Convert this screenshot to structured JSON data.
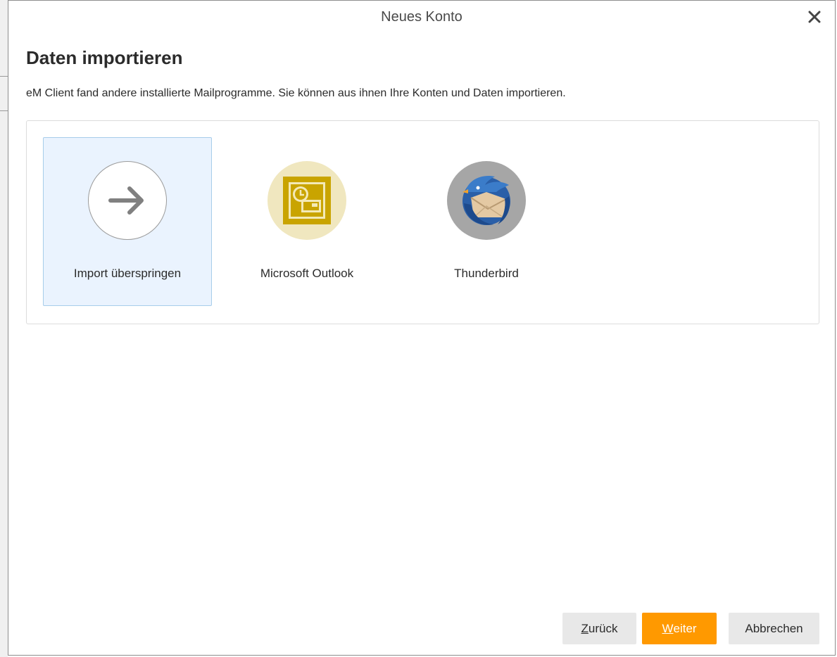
{
  "dialog": {
    "title": "Neues Konto",
    "heading": "Daten importieren",
    "description": "eM Client fand andere installierte Mailprogramme. Sie können aus ihnen Ihre Konten und Daten importieren."
  },
  "options": [
    {
      "label": "Import überspringen",
      "icon": "arrow-right-icon",
      "selected": true
    },
    {
      "label": "Microsoft Outlook",
      "icon": "outlook-icon",
      "selected": false
    },
    {
      "label": "Thunderbird",
      "icon": "thunderbird-icon",
      "selected": false
    }
  ],
  "buttons": {
    "back": {
      "mnemonic": "Z",
      "rest": "urück"
    },
    "next": {
      "mnemonic": "W",
      "rest": "eiter"
    },
    "cancel": {
      "label": "Abbrechen"
    }
  },
  "colors": {
    "accent": "#ff9900",
    "selected_bg": "#eaf3fe",
    "selected_border": "#a7cdea",
    "outlook_gold": "#c9a400",
    "thunderbird_bg": "#a6a6a6"
  }
}
